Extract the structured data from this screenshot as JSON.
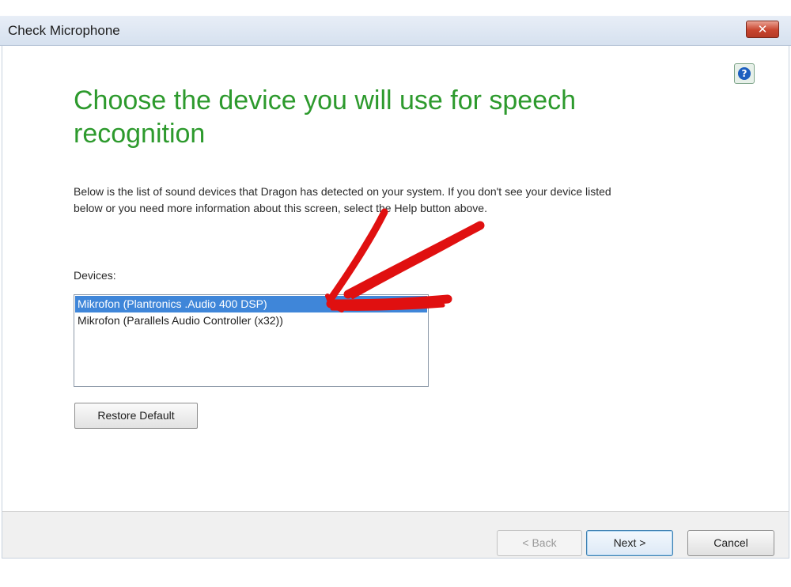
{
  "window": {
    "title": "Check Microphone",
    "close_symbol": "✕",
    "help_symbol": "?"
  },
  "main": {
    "heading": "Choose the device you will use for speech recognition",
    "description": "Below is the list of sound devices that Dragon has detected on your system. If you don't see your device listed below or you need more information about this screen, select the Help button above.",
    "devices_label": "Devices:",
    "devices": [
      {
        "label": "Mikrofon (Plantronics .Audio 400 DSP)",
        "selected": true
      },
      {
        "label": "Mikrofon (Parallels Audio Controller (x32))",
        "selected": false
      }
    ],
    "restore_label": "Restore Default"
  },
  "footer": {
    "back_label": "< Back",
    "next_label": "Next >",
    "cancel_label": "Cancel"
  },
  "colors": {
    "heading": "#2d9a2d",
    "selection": "#3f86d9",
    "annotation_arrow": "#e01010"
  },
  "icons": {
    "close": "close-icon",
    "help": "help-icon",
    "annotation": "arrow-annotation"
  }
}
